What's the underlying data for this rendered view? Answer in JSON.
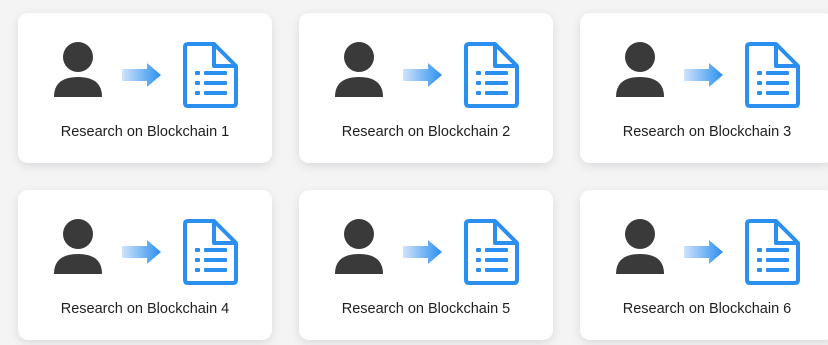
{
  "cards": [
    {
      "label": "Research on Blockchain 1",
      "person_icon": "person-icon",
      "arrow_icon": "arrow-right-icon",
      "doc_icon": "document-list-icon"
    },
    {
      "label": "Research on Blockchain 2",
      "person_icon": "person-icon",
      "arrow_icon": "arrow-right-icon",
      "doc_icon": "document-list-icon"
    },
    {
      "label": "Research on Blockchain 3",
      "person_icon": "person-icon",
      "arrow_icon": "arrow-right-icon",
      "doc_icon": "document-list-icon"
    },
    {
      "label": "Research on Blockchain 4",
      "person_icon": "person-icon",
      "arrow_icon": "arrow-right-icon",
      "doc_icon": "document-list-icon"
    },
    {
      "label": "Research on Blockchain 5",
      "person_icon": "person-icon",
      "arrow_icon": "arrow-right-icon",
      "doc_icon": "document-list-icon"
    },
    {
      "label": "Research on Blockchain 6",
      "person_icon": "person-icon",
      "arrow_icon": "arrow-right-icon",
      "doc_icon": "document-list-icon"
    }
  ],
  "colors": {
    "person": "#3a3a3a",
    "arrow_start": "#cfe3fb",
    "arrow_end": "#2b8ff0",
    "document": "#2b8ff0",
    "card_bg": "#ffffff",
    "page_bg": "#f4f4f5"
  }
}
